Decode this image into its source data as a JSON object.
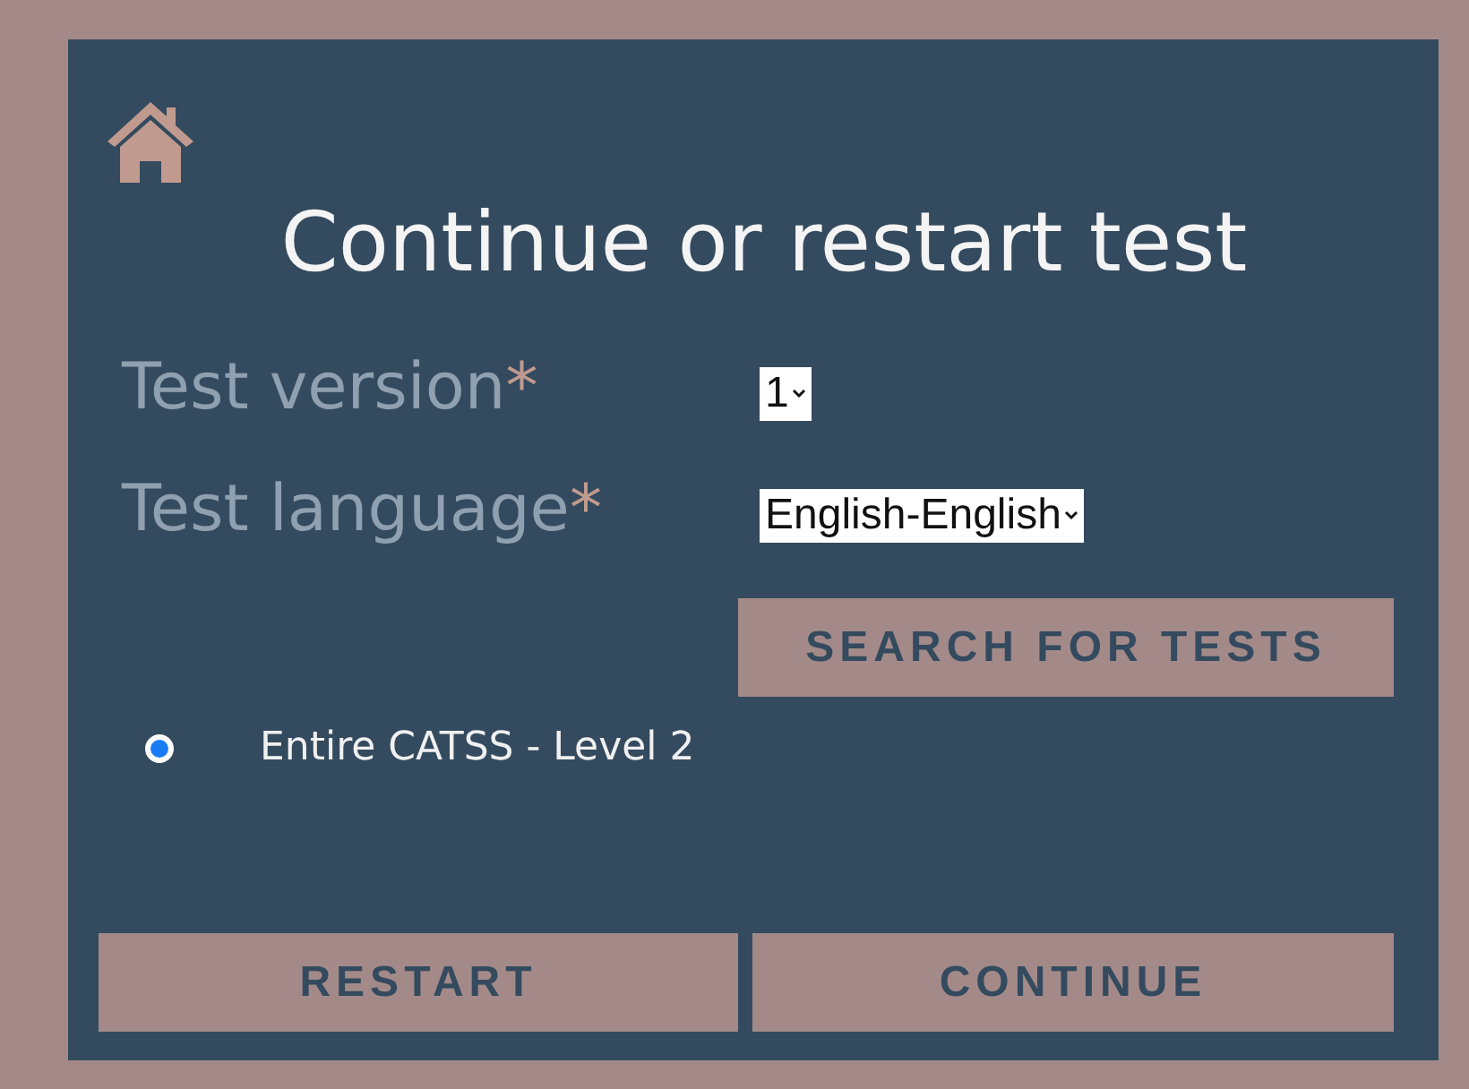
{
  "title": "Continue or restart test",
  "fields": [
    {
      "label": "Test version",
      "required_mark": "*",
      "value": "1"
    },
    {
      "label": "Test language",
      "required_mark": "*",
      "value": "English-English"
    }
  ],
  "search_button": "SEARCH FOR TESTS",
  "options": [
    {
      "label": "Entire CATSS - Level 2",
      "selected": true
    }
  ],
  "buttons": [
    "RESTART",
    "CONTINUE"
  ]
}
